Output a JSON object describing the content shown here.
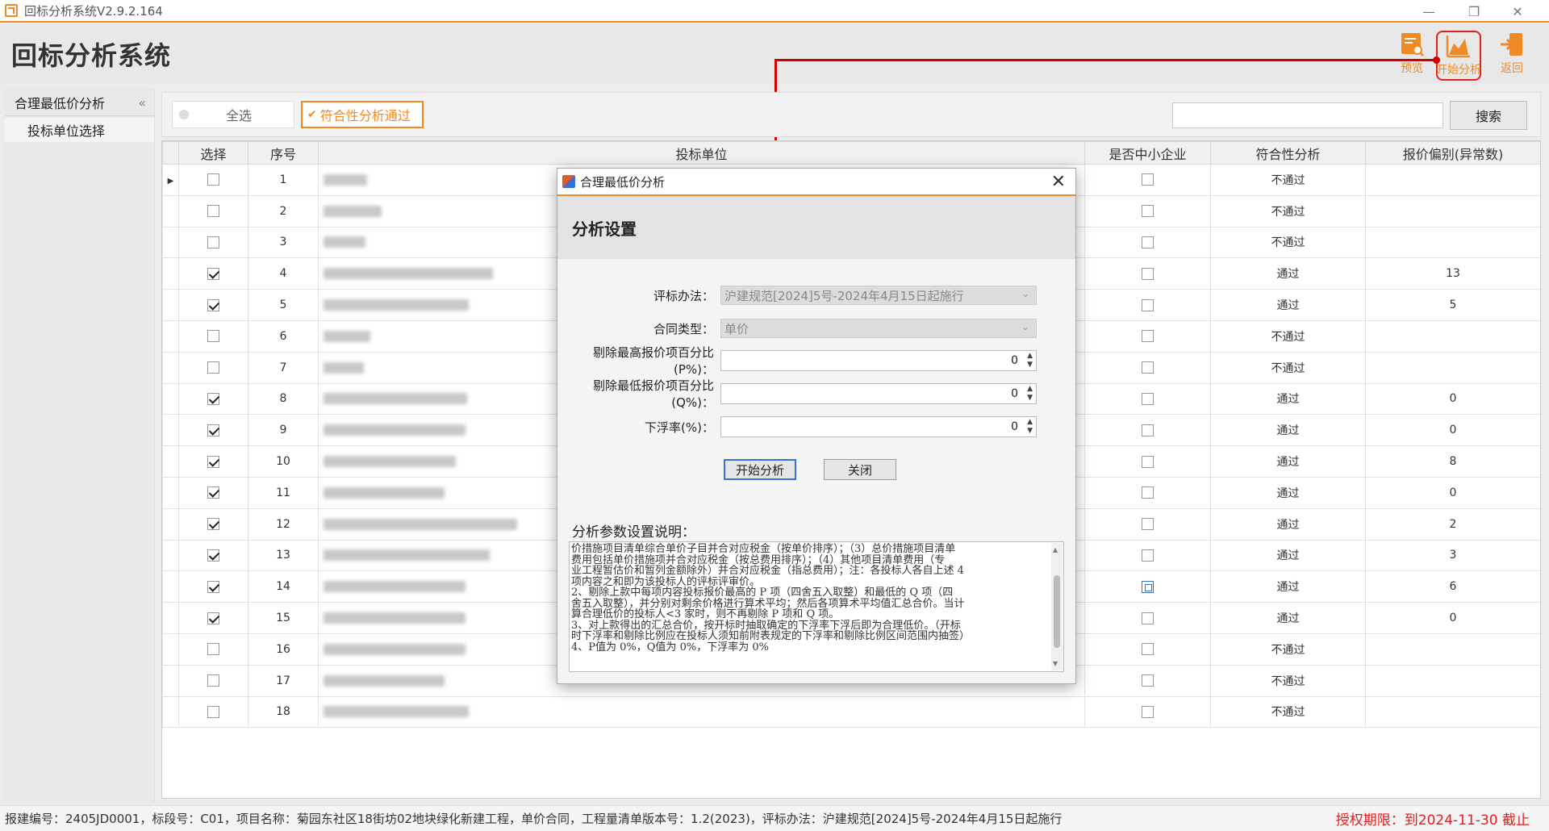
{
  "window": {
    "title": "回标分析系统V2.9.2.164",
    "controls": {
      "minimize": "—",
      "restore": "❐",
      "close": "✕"
    }
  },
  "header": {
    "app_title": "回标分析系统",
    "tools": [
      {
        "label": "预览",
        "icon": "preview-doc-icon"
      },
      {
        "label": "开始分析",
        "icon": "area-chart-icon"
      },
      {
        "label": "返回",
        "icon": "exit-door-icon"
      }
    ],
    "accent_color": "#f08a24",
    "highlight_color": "#e02020"
  },
  "sidebar": {
    "group_label": "合理最低价分析",
    "collapse_glyph": "«",
    "items": [
      {
        "label": "投标单位选择"
      }
    ]
  },
  "filterbar": {
    "select_all_label": "全选",
    "pass_filter_label": "符合性分析通过",
    "search_value": "",
    "search_button_label": "搜索"
  },
  "table": {
    "columns": [
      "选择",
      "序号",
      "投标单位",
      "是否中小企业",
      "符合性分析",
      "报价偏别(异常数)"
    ],
    "rows": [
      {
        "selected": false,
        "no": "1",
        "sme": false,
        "compliance": "不通过",
        "anomaly": ""
      },
      {
        "selected": false,
        "no": "2",
        "sme": false,
        "compliance": "不通过",
        "anomaly": ""
      },
      {
        "selected": false,
        "no": "3",
        "sme": false,
        "compliance": "不通过",
        "anomaly": ""
      },
      {
        "selected": true,
        "no": "4",
        "sme": false,
        "compliance": "通过",
        "anomaly": "13"
      },
      {
        "selected": true,
        "no": "5",
        "sme": false,
        "compliance": "通过",
        "anomaly": "5"
      },
      {
        "selected": false,
        "no": "6",
        "sme": false,
        "compliance": "不通过",
        "anomaly": ""
      },
      {
        "selected": false,
        "no": "7",
        "sme": false,
        "compliance": "不通过",
        "anomaly": ""
      },
      {
        "selected": true,
        "no": "8",
        "sme": false,
        "compliance": "通过",
        "anomaly": "0"
      },
      {
        "selected": true,
        "no": "9",
        "sme": false,
        "compliance": "通过",
        "anomaly": "0"
      },
      {
        "selected": true,
        "no": "10",
        "sme": false,
        "compliance": "通过",
        "anomaly": "8"
      },
      {
        "selected": true,
        "no": "11",
        "sme": false,
        "compliance": "通过",
        "anomaly": "0"
      },
      {
        "selected": true,
        "no": "12",
        "sme": false,
        "compliance": "通过",
        "anomaly": "2"
      },
      {
        "selected": true,
        "no": "13",
        "sme": false,
        "compliance": "通过",
        "anomaly": "3"
      },
      {
        "selected": true,
        "no": "14",
        "sme": false,
        "compliance": "通过",
        "anomaly": "6"
      },
      {
        "selected": true,
        "no": "15",
        "sme": false,
        "compliance": "通过",
        "anomaly": "0"
      },
      {
        "selected": false,
        "no": "16",
        "sme": false,
        "compliance": "不通过",
        "anomaly": ""
      },
      {
        "selected": false,
        "no": "17",
        "sme": false,
        "compliance": "不通过",
        "anomaly": ""
      },
      {
        "selected": false,
        "no": "18",
        "sme": false,
        "compliance": "不通过",
        "anomaly": ""
      }
    ]
  },
  "statusbar": {
    "info": "报建编号：2405JD0001，标段号：C01，项目名称：菊园东社区18街坊02地块绿化新建工程，单价合同，工程量清单版本号：1.2(2023)，评标办法：沪建规范[2024]5号-2024年4月15日起施行",
    "license": "授权期限：到2024-11-30 截止"
  },
  "dialog": {
    "title": "合理最低价分析",
    "heading": "分析设置",
    "fields": {
      "method_label": "评标办法：",
      "method_value": "沪建规范[2024]5号-2024年4月15日起施行",
      "contract_label": "合同类型：",
      "contract_value": "单价",
      "high_pct_label": "剔除最高报价项百分比(P%)：",
      "high_pct_value": "0",
      "low_pct_label": "剔除最低报价项百分比(Q%)：",
      "low_pct_value": "0",
      "float_label": "下浮率(%)：",
      "float_value": "0"
    },
    "start_button": "开始分析",
    "close_button": "关闭",
    "notes_title": "分析参数设置说明：",
    "notes": [
      "价措施项目清单综合单价子目并合对应税金（按单价排序）；（3）总价措施项目清单",
      "费用包括单价措施项并合对应税金（按总费用排序）；（4）其他项目清单费用（专",
      "业工程暂估价和暂列金额除外）并合对应税金（指总费用）；注：各投标人各自上述 4",
      "项内容之和即为该投标人的评标评审价。",
      "2、剔除上款中每项内容投标报价最高的 P 项（四舍五入取整）和最低的 Q 项（四",
      "舍五入取整），并分别对剩余价格进行算术平均；然后各项算术平均值汇总合价。当计",
      "算合理低价的投标人<3 家时，则不再剔除 P 项和 Q 项。",
      "3、对上款得出的汇总合价，按开标时抽取确定的下浮率下浮后即为合理低价。（开标",
      "时下浮率和剔除比例应在投标人须知前附表规定的下浮率和剔除比例区间范围内抽签）",
      "4、P值为 0%，Q值为 0%，下浮率为 0%"
    ]
  }
}
